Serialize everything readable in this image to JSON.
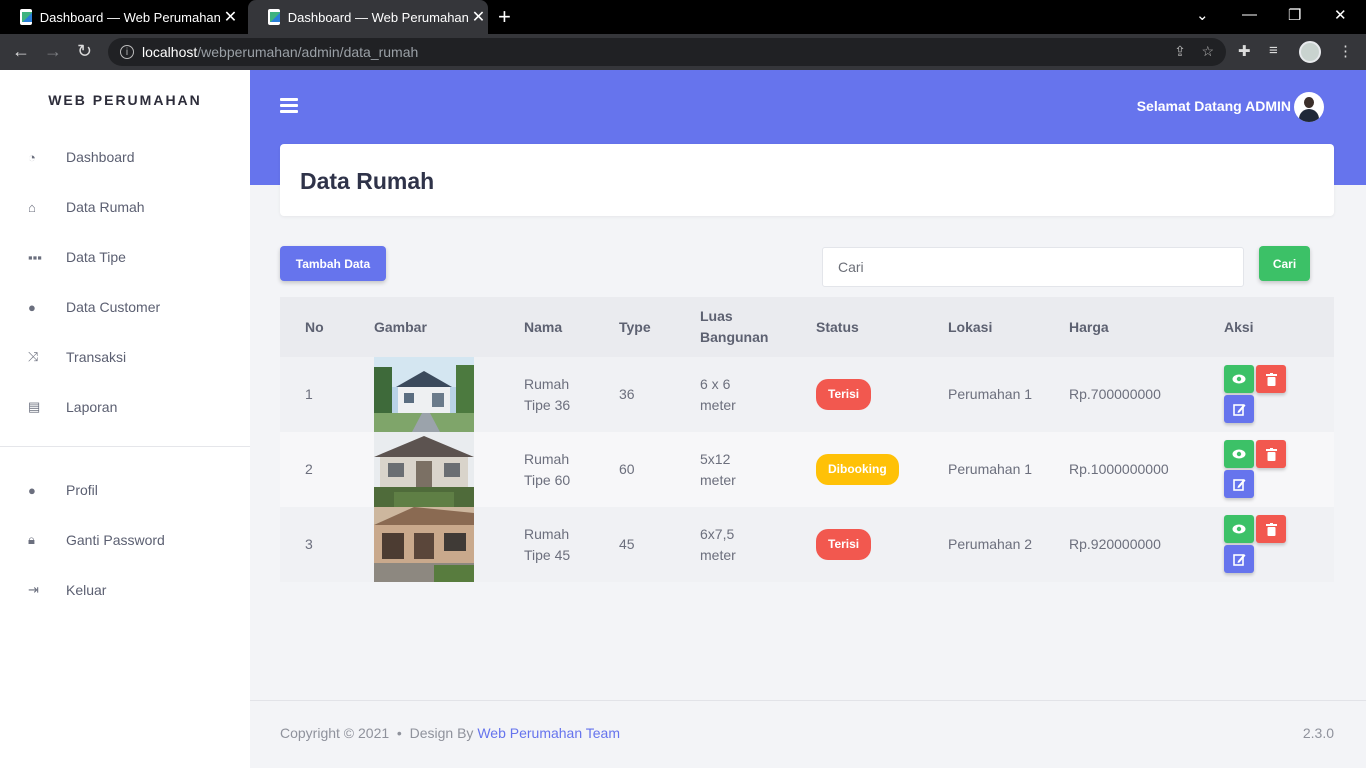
{
  "browser": {
    "tabs": [
      {
        "title": "Dashboard — Web Perumahan"
      },
      {
        "title": "Dashboard — Web Perumahan"
      }
    ],
    "url_host": "localhost",
    "url_path": "/webperumahan/admin/data_rumah"
  },
  "sidebar": {
    "brand": "WEB PERUMAHAN",
    "items": [
      {
        "label": "Dashboard",
        "icon": "dashboard-icon"
      },
      {
        "label": "Data Rumah",
        "icon": "home-icon"
      },
      {
        "label": "Data Tipe",
        "icon": "grid-icon"
      },
      {
        "label": "Data Customer",
        "icon": "user-icon"
      },
      {
        "label": "Transaksi",
        "icon": "shuffle-icon"
      },
      {
        "label": "Laporan",
        "icon": "clipboard-icon"
      }
    ],
    "bottom_items": [
      {
        "label": "Profil",
        "icon": "user-icon"
      },
      {
        "label": "Ganti Password",
        "icon": "lock-icon"
      },
      {
        "label": "Keluar",
        "icon": "sign-out-icon"
      }
    ]
  },
  "header": {
    "welcome": "Selamat Datang ADMIN"
  },
  "page": {
    "title": "Data Rumah"
  },
  "toolbar": {
    "add_label": "Tambah Data",
    "search_placeholder": "Cari",
    "search_button": "Cari"
  },
  "table": {
    "columns": [
      "No",
      "Gambar",
      "Nama",
      "Type",
      "Luas Bangunan",
      "Status",
      "Lokasi",
      "Harga",
      "Aksi"
    ],
    "rows": [
      {
        "no": "1",
        "nama": "Rumah Tipe 36",
        "type": "36",
        "luas": "6 x 6 meter",
        "status": "Terisi",
        "lokasi": "Perumahan 1",
        "harga": "Rp.700000000"
      },
      {
        "no": "2",
        "nama": "Rumah Tipe 60",
        "type": "60",
        "luas": "5x12 meter",
        "status": "Dibooking",
        "lokasi": "Perumahan 1",
        "harga": "Rp.1000000000"
      },
      {
        "no": "3",
        "nama": "Rumah Tipe 45",
        "type": "45",
        "luas": "6x7,5 meter",
        "status": "Terisi",
        "lokasi": "Perumahan 2",
        "harga": "Rp.920000000"
      }
    ]
  },
  "footer": {
    "copyright": "Copyright © 2021",
    "design_by": "Design By",
    "team": "Web Perumahan Team",
    "version": "2.3.0"
  },
  "colors": {
    "primary": "#6674ed",
    "success": "#3cc167",
    "danger": "#f2584f",
    "warning": "#ffc107"
  }
}
